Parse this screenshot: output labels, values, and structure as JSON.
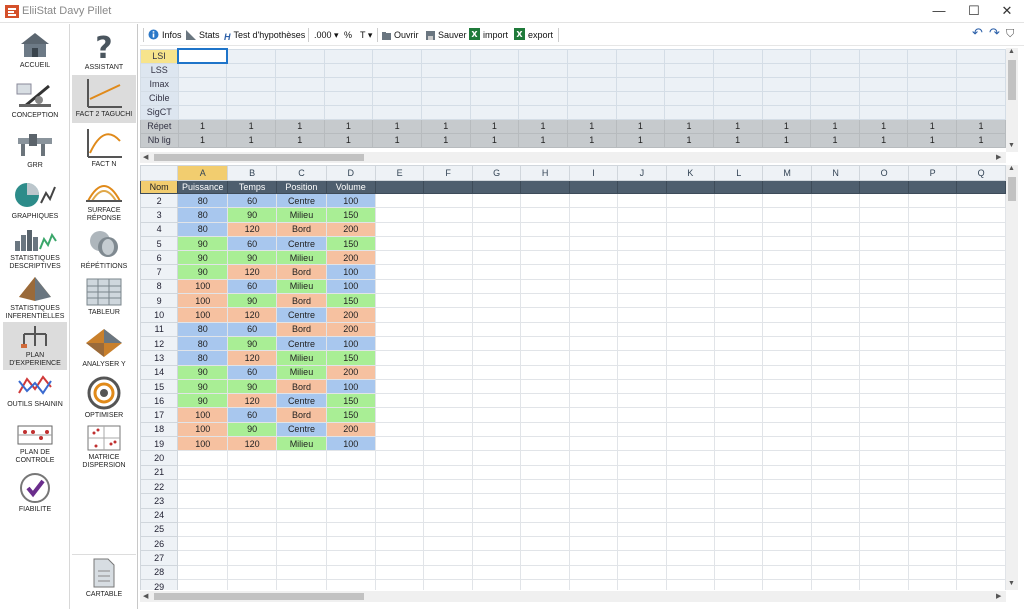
{
  "window": {
    "title": "EliiStat Davy Pillet",
    "minimize": "—",
    "maximize": "☐",
    "close": "✕"
  },
  "sidebar_left": [
    {
      "label": "ACCUEIL",
      "icon": "house-icon"
    },
    {
      "label": "CONCEPTION",
      "icon": "drafting-icon"
    },
    {
      "label": "GRR",
      "icon": "caliper-icon"
    },
    {
      "label": "GRAPHIQUES",
      "icon": "pie-chart-icon"
    },
    {
      "label": "STATISTIQUES DESCRIPTIVES",
      "icon": "histogram-icon"
    },
    {
      "label": "STATISTIQUES INFERENTIELLES",
      "icon": "pyramid-icon"
    },
    {
      "label": "PLAN D'EXPERIENCE",
      "icon": "tree-diagram-icon"
    },
    {
      "label": "OUTILS SHAININ",
      "icon": "lines-chart-icon"
    },
    {
      "label": "PLAN DE CONTROLE",
      "icon": "grid-dots-icon"
    },
    {
      "label": "FIABILITE",
      "icon": "checkmark-icon"
    }
  ],
  "sidebar_right": [
    {
      "label": "ASSISTANT",
      "icon": "question-mark-icon"
    },
    {
      "label": "FACT 2 TAGUCHI",
      "icon": "line-graph-icon"
    },
    {
      "label": "FACT N",
      "icon": "curve-graph-icon"
    },
    {
      "label": "SURFACE RÉPONSE",
      "icon": "dome-icon"
    },
    {
      "label": "RÉPÉTITIONS",
      "icon": "cylinders-icon"
    },
    {
      "label": "TABLEUR",
      "icon": "spreadsheet-icon"
    },
    {
      "label": "ANALYSER Y",
      "icon": "diamond-surface-icon"
    },
    {
      "label": "OPTIMISER",
      "icon": "target-icon"
    },
    {
      "label": "MATRICE DISPERSION",
      "icon": "scatter-matrix-icon"
    },
    {
      "label": "CARTABLE",
      "icon": "document-icon"
    }
  ],
  "toolbar": {
    "infos": "Infos",
    "stats": "Stats",
    "tests": "Test d'hypothèses",
    "decimals": ".000",
    "percent": "%",
    "text_format": "T",
    "open": "Ouvrir",
    "save": "Sauver",
    "import": "import",
    "export": "export",
    "undo": "↶",
    "redo": "↷",
    "filter": "⛉"
  },
  "spec_rows": [
    {
      "label": "LSI",
      "values": [
        "",
        "",
        "",
        "",
        "",
        "",
        "",
        "",
        "",
        "",
        "",
        "",
        "",
        "",
        "",
        "",
        ""
      ]
    },
    {
      "label": "LSS",
      "values": [
        "",
        "",
        "",
        "",
        "",
        "",
        "",
        "",
        "",
        "",
        "",
        "",
        "",
        "",
        "",
        "",
        ""
      ]
    },
    {
      "label": "Imax",
      "values": [
        "",
        "",
        "",
        "",
        "",
        "",
        "",
        "",
        "",
        "",
        "",
        "",
        "",
        "",
        "",
        "",
        ""
      ]
    },
    {
      "label": "Cible",
      "values": [
        "",
        "",
        "",
        "",
        "",
        "",
        "",
        "",
        "",
        "",
        "",
        "",
        "",
        "",
        "",
        "",
        ""
      ]
    },
    {
      "label": "SigCT",
      "values": [
        "",
        "",
        "",
        "",
        "",
        "",
        "",
        "",
        "",
        "",
        "",
        "",
        "",
        "",
        "",
        "",
        ""
      ]
    },
    {
      "label": "Répet",
      "values": [
        "1",
        "1",
        "1",
        "1",
        "1",
        "1",
        "1",
        "1",
        "1",
        "1",
        "1",
        "1",
        "1",
        "1",
        "1",
        "1",
        "1"
      ]
    },
    {
      "label": "Nb lig",
      "values": [
        "1",
        "1",
        "1",
        "1",
        "1",
        "1",
        "1",
        "1",
        "1",
        "1",
        "1",
        "1",
        "1",
        "1",
        "1",
        "1",
        "1"
      ]
    }
  ],
  "grid": {
    "columns": [
      "A",
      "B",
      "C",
      "D",
      "E",
      "F",
      "G",
      "H",
      "I",
      "J",
      "K",
      "L",
      "M",
      "N",
      "O",
      "P",
      "Q"
    ],
    "name_row_label": "Nom",
    "variable_names": [
      "Puissance",
      "Temps",
      "Position",
      "Volume"
    ],
    "rows": [
      {
        "n": "2",
        "cells": [
          [
            "80",
            "blue"
          ],
          [
            "60",
            "blue"
          ],
          [
            "Centre",
            "blue"
          ],
          [
            "100",
            "blue"
          ]
        ]
      },
      {
        "n": "3",
        "cells": [
          [
            "80",
            "blue"
          ],
          [
            "90",
            "green"
          ],
          [
            "Milieu",
            "green"
          ],
          [
            "150",
            "green"
          ]
        ]
      },
      {
        "n": "4",
        "cells": [
          [
            "80",
            "blue"
          ],
          [
            "120",
            "orange"
          ],
          [
            "Bord",
            "orange"
          ],
          [
            "200",
            "orange"
          ]
        ]
      },
      {
        "n": "5",
        "cells": [
          [
            "90",
            "green"
          ],
          [
            "60",
            "blue"
          ],
          [
            "Centre",
            "blue"
          ],
          [
            "150",
            "green"
          ]
        ]
      },
      {
        "n": "6",
        "cells": [
          [
            "90",
            "green"
          ],
          [
            "90",
            "green"
          ],
          [
            "Milieu",
            "green"
          ],
          [
            "200",
            "orange"
          ]
        ]
      },
      {
        "n": "7",
        "cells": [
          [
            "90",
            "green"
          ],
          [
            "120",
            "orange"
          ],
          [
            "Bord",
            "orange"
          ],
          [
            "100",
            "blue"
          ]
        ]
      },
      {
        "n": "8",
        "cells": [
          [
            "100",
            "orange"
          ],
          [
            "60",
            "blue"
          ],
          [
            "Milieu",
            "green"
          ],
          [
            "100",
            "blue"
          ]
        ]
      },
      {
        "n": "9",
        "cells": [
          [
            "100",
            "orange"
          ],
          [
            "90",
            "green"
          ],
          [
            "Bord",
            "orange"
          ],
          [
            "150",
            "green"
          ]
        ]
      },
      {
        "n": "10",
        "cells": [
          [
            "100",
            "orange"
          ],
          [
            "120",
            "orange"
          ],
          [
            "Centre",
            "blue"
          ],
          [
            "200",
            "orange"
          ]
        ]
      },
      {
        "n": "11",
        "cells": [
          [
            "80",
            "blue"
          ],
          [
            "60",
            "blue"
          ],
          [
            "Bord",
            "orange"
          ],
          [
            "200",
            "orange"
          ]
        ]
      },
      {
        "n": "12",
        "cells": [
          [
            "80",
            "blue"
          ],
          [
            "90",
            "green"
          ],
          [
            "Centre",
            "blue"
          ],
          [
            "100",
            "blue"
          ]
        ]
      },
      {
        "n": "13",
        "cells": [
          [
            "80",
            "blue"
          ],
          [
            "120",
            "orange"
          ],
          [
            "Milieu",
            "green"
          ],
          [
            "150",
            "green"
          ]
        ]
      },
      {
        "n": "14",
        "cells": [
          [
            "90",
            "green"
          ],
          [
            "60",
            "blue"
          ],
          [
            "Milieu",
            "green"
          ],
          [
            "200",
            "orange"
          ]
        ]
      },
      {
        "n": "15",
        "cells": [
          [
            "90",
            "green"
          ],
          [
            "90",
            "green"
          ],
          [
            "Bord",
            "orange"
          ],
          [
            "100",
            "blue"
          ]
        ]
      },
      {
        "n": "16",
        "cells": [
          [
            "90",
            "green"
          ],
          [
            "120",
            "orange"
          ],
          [
            "Centre",
            "blue"
          ],
          [
            "150",
            "green"
          ]
        ]
      },
      {
        "n": "17",
        "cells": [
          [
            "100",
            "orange"
          ],
          [
            "60",
            "blue"
          ],
          [
            "Bord",
            "orange"
          ],
          [
            "150",
            "green"
          ]
        ]
      },
      {
        "n": "18",
        "cells": [
          [
            "100",
            "orange"
          ],
          [
            "90",
            "green"
          ],
          [
            "Centre",
            "blue"
          ],
          [
            "200",
            "orange"
          ]
        ]
      },
      {
        "n": "19",
        "cells": [
          [
            "100",
            "orange"
          ],
          [
            "120",
            "orange"
          ],
          [
            "Milieu",
            "green"
          ],
          [
            "100",
            "blue"
          ]
        ]
      },
      {
        "n": "20",
        "cells": []
      },
      {
        "n": "21",
        "cells": []
      },
      {
        "n": "22",
        "cells": []
      },
      {
        "n": "23",
        "cells": []
      },
      {
        "n": "24",
        "cells": []
      },
      {
        "n": "25",
        "cells": []
      },
      {
        "n": "26",
        "cells": []
      },
      {
        "n": "27",
        "cells": []
      },
      {
        "n": "28",
        "cells": []
      },
      {
        "n": "29",
        "cells": []
      }
    ]
  },
  "colors": {
    "level_low": "#a8c7ee",
    "level_mid": "#a9ee95",
    "level_high": "#f6c1a0",
    "header_dark": "#4e5e6e",
    "selected_col": "#f2cd6f"
  }
}
